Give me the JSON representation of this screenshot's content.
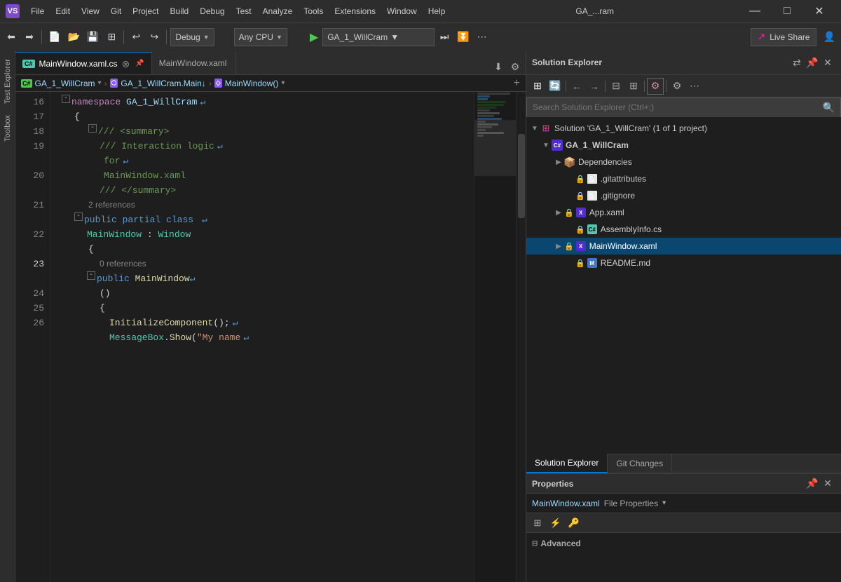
{
  "titlebar": {
    "logo": "VS",
    "menu_items": [
      "File",
      "Edit",
      "View",
      "Git",
      "Project",
      "Build",
      "Debug",
      "Test",
      "Analyze",
      "Tools",
      "Extensions",
      "Window",
      "Help"
    ],
    "window_title": "GA_...ram",
    "minimize": "—",
    "maximize": "□",
    "close": "✕"
  },
  "toolbar": {
    "back_btn": "←",
    "forward_btn": "→",
    "debug_config": "Debug",
    "platform": "Any CPU",
    "run_target": "GA_1_WillCram",
    "live_share_label": "Live Share",
    "run_icon": "▶"
  },
  "editor": {
    "tabs": [
      {
        "name": "MainWindow.xaml.cs",
        "active": true,
        "modified": false
      },
      {
        "name": "MainWindow.xaml",
        "active": false,
        "modified": false
      }
    ],
    "breadcrumb": {
      "project": "GA_1_WillCram",
      "namespace": "GA_1_WillCram.Main↓",
      "member": "MainWindow()"
    },
    "lines": [
      {
        "num": 16,
        "content": "namespace GA_1_WillCram",
        "type": "namespace"
      },
      {
        "num": 17,
        "content": "{",
        "type": "brace"
      },
      {
        "num": 18,
        "content": "/// <summary>",
        "type": "comment"
      },
      {
        "num": 19,
        "content": "/// Interaction logic for MainWindow.xaml",
        "type": "comment-long"
      },
      {
        "num": 20,
        "content": "/// </summary>",
        "type": "comment"
      },
      {
        "num": "ref1",
        "content": "2 references",
        "type": "reference"
      },
      {
        "num": 21,
        "content": "public partial class MainWindow : Window",
        "type": "class-def"
      },
      {
        "num": 22,
        "content": "{",
        "type": "brace"
      },
      {
        "num": "ref2",
        "content": "0 references",
        "type": "reference"
      },
      {
        "num": 23,
        "content": "public MainWindow()",
        "type": "method-def"
      },
      {
        "num": 24,
        "content": "{",
        "type": "brace"
      },
      {
        "num": 25,
        "content": "InitializeComponent();",
        "type": "method-call"
      },
      {
        "num": 26,
        "content": "MessageBox.Show(\"My name",
        "type": "method-call-partial"
      }
    ]
  },
  "solution_explorer": {
    "title": "Solution Explorer",
    "search_placeholder": "Search Solution Explorer (Ctrl+;)",
    "solution_name": "Solution 'GA_1_WillCram' (1 of 1 project)",
    "project_name": "GA_1_WillCram",
    "items": [
      {
        "name": "Dependencies",
        "type": "folder",
        "level": 2,
        "expanded": false
      },
      {
        "name": ".gitattributes",
        "type": "file-doc",
        "level": 2,
        "locked": true
      },
      {
        "name": ".gitignore",
        "type": "file-doc",
        "level": 2,
        "locked": true
      },
      {
        "name": "App.xaml",
        "type": "file-xaml",
        "level": 2,
        "locked": true,
        "expanded": false
      },
      {
        "name": "AssemblyInfo.cs",
        "type": "file-cs",
        "level": 2,
        "locked": true
      },
      {
        "name": "MainWindow.xaml",
        "type": "file-xaml",
        "level": 2,
        "locked": true,
        "active": true,
        "expanded": true
      },
      {
        "name": "README.md",
        "type": "file-md",
        "level": 2,
        "locked": true
      }
    ],
    "bottom_tabs": [
      {
        "label": "Solution Explorer",
        "active": true
      },
      {
        "label": "Git Changes",
        "active": false
      }
    ]
  },
  "properties": {
    "title": "Properties",
    "file_name": "MainWindow.xaml",
    "file_type": "File Properties",
    "section": "Advanced"
  },
  "colors": {
    "accent": "#007acc",
    "bg_dark": "#1e1e1e",
    "bg_mid": "#2d2d2d",
    "active_tab_border": "#007acc"
  }
}
